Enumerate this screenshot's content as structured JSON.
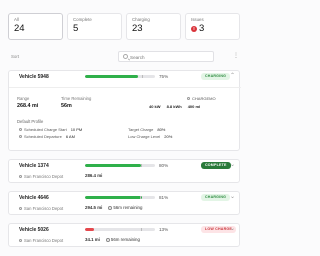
{
  "stats": [
    {
      "label": "All",
      "value": "24"
    },
    {
      "label": "Complete",
      "value": "5"
    },
    {
      "label": "Charging",
      "value": "23"
    },
    {
      "label": "Issues",
      "value": "3"
    }
  ],
  "toolbar": {
    "sort_label": "Sort",
    "search_placeholder": "Search",
    "menu_icon": "⋮"
  },
  "colors": {
    "green": "#2fb04a",
    "red": "#e5484d",
    "charging_bg": "#e3f5e6",
    "charging_fg": "#2b8a3e",
    "complete_bg": "#2a7a3a",
    "low_bg": "#fde4e6",
    "low_fg": "#c9343b"
  },
  "vehicles": [
    {
      "name": "Vehicle 5948",
      "percent": "75%",
      "fill": 0.75,
      "marker": 0.82,
      "status": "CHARGING",
      "details": {
        "range_label": "Range",
        "range_value": "268.4 mi",
        "time_label": "Time Remaining",
        "time_value": "56m",
        "chargeamo_label": "CHARGEMO",
        "power_value": "40 kW",
        "energy_value": "8.8 kWh",
        "third_value": "400 ml",
        "profile_title": "Default Profile",
        "sched_charge_label": "Scheduled Charge Start",
        "sched_charge_value": "10 PM",
        "sched_depart_label": "Scheduled Departure",
        "sched_depart_value": "6 AM",
        "target_label": "Target Charge",
        "target_value": "80%",
        "low_label": "Low Charge Level",
        "low_value": "20%"
      }
    },
    {
      "name": "Vehicle 1374",
      "location": "San Francisco Depot",
      "percent": "80%",
      "fill": 0.8,
      "marker": 0.8,
      "range": "286.4 mi",
      "time": "",
      "status": "COMPLETE"
    },
    {
      "name": "Vehicle 4646",
      "location": "San Francisco Depot",
      "percent": "81%",
      "fill": 0.81,
      "marker": 0.78,
      "range": "294.5 mi",
      "time": "56m remaining",
      "status": "CHARGING"
    },
    {
      "name": "Vehicle 5026",
      "location": "San Francisco Depot",
      "percent": "13%",
      "fill": 0.13,
      "marker": 0.8,
      "range": "34.1 mi",
      "time": "56m remaining",
      "status": "LOW CHARGE"
    }
  ]
}
